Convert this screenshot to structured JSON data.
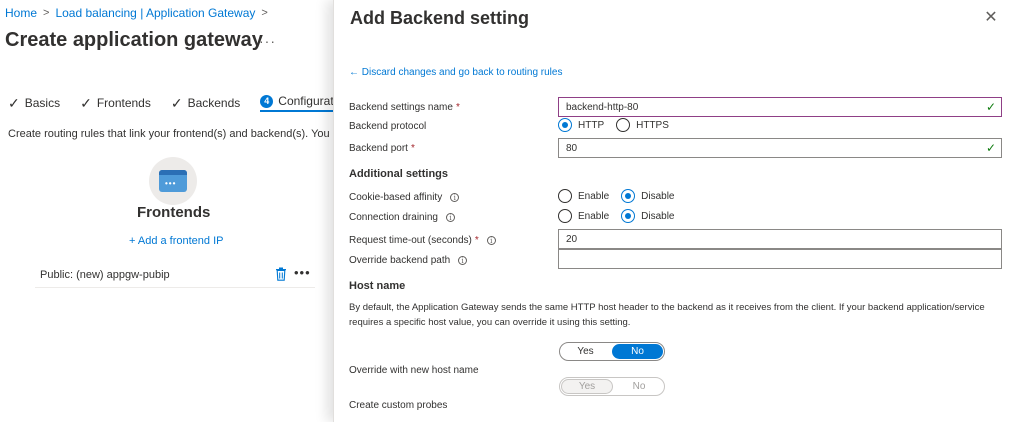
{
  "breadcrumb": {
    "home": "Home",
    "parent": "Load balancing | Application Gateway"
  },
  "page": {
    "title": "Create application gateway",
    "more": "···"
  },
  "tabs": [
    {
      "label": "Basics"
    },
    {
      "label": "Frontends"
    },
    {
      "label": "Backends"
    },
    {
      "num": "4",
      "label": "Configuration"
    }
  ],
  "routing_desc": "Create routing rules that link your frontend(s) and backend(s). You can",
  "frontends": {
    "title": "Frontends",
    "add_link": "+ Add a frontend IP",
    "items": [
      {
        "label": "Public: (new) appgw-pubip"
      }
    ]
  },
  "panel": {
    "title": "Add Backend setting",
    "close": "✕",
    "discard_link": "← Discard changes and go back to routing rules",
    "settings_name": {
      "label": "Backend settings name",
      "value": "backend-http-80"
    },
    "protocol": {
      "label": "Backend protocol",
      "options": [
        "HTTP",
        "HTTPS"
      ],
      "selected": "HTTP"
    },
    "port": {
      "label": "Backend port",
      "value": "80"
    },
    "additional_title": "Additional settings",
    "cookie": {
      "label": "Cookie-based affinity",
      "options": [
        "Enable",
        "Disable"
      ],
      "selected": "Disable"
    },
    "draining": {
      "label": "Connection draining",
      "options": [
        "Enable",
        "Disable"
      ],
      "selected": "Disable"
    },
    "timeout": {
      "label": "Request time-out (seconds)",
      "value": "20"
    },
    "override_path": {
      "label": "Override backend path",
      "value": ""
    },
    "hostname_title": "Host name",
    "hostname_desc": "By default, the Application Gateway sends the same HTTP host header to the backend as it receives from the client. If your backend application/service requires a specific host value, you can override it using this setting.",
    "override_host": {
      "label": "Override with new host name",
      "options": [
        "Yes",
        "No"
      ],
      "selected": "No"
    },
    "custom_probes": {
      "label": "Create custom probes",
      "options": [
        "Yes",
        "No"
      ],
      "selected": "Yes",
      "disabled": true
    }
  },
  "colors": {
    "accent": "#0078d4",
    "required": "#a4262c",
    "valid": "#107c10"
  }
}
